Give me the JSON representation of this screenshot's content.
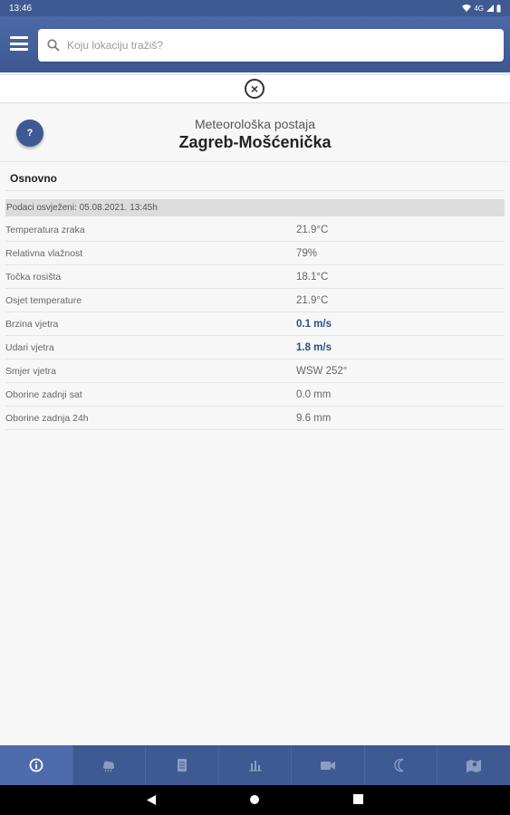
{
  "status_bar": {
    "time": "13:46",
    "network": "4G"
  },
  "search": {
    "placeholder": "Koju lokaciju tražiš?"
  },
  "help_button": {
    "label": "?"
  },
  "station": {
    "subtitle": "Meteorološka postaja",
    "name": "Zagreb-Mošćenička"
  },
  "section": {
    "title": "Osnovno"
  },
  "refresh": {
    "text": "Podaci osvježeni: 05.08.2021. 13:45h"
  },
  "rows": [
    {
      "label": "Temperatura zraka",
      "value": "21.9°C",
      "highlight": false
    },
    {
      "label": "Relativna vlažnost",
      "value": "79%",
      "highlight": false
    },
    {
      "label": "Točka rosišta",
      "value": "18.1°C",
      "highlight": false
    },
    {
      "label": "Osjet temperature",
      "value": "21.9°C",
      "highlight": false
    },
    {
      "label": "Brzina vjetra",
      "value": "0.1 m/s",
      "highlight": true
    },
    {
      "label": "Udari vjetra",
      "value": "1.8 m/s",
      "highlight": true
    },
    {
      "label": "Smjer vjetra",
      "value": "WSW 252°",
      "highlight": false
    },
    {
      "label": "Oborine zadnji sat",
      "value": "0.0 mm",
      "highlight": false
    },
    {
      "label": "Oborine zadnja 24h",
      "value": "9.6 mm",
      "highlight": false
    }
  ],
  "bottom_nav": [
    {
      "name": "tab-info",
      "icon": "info-icon",
      "active": true
    },
    {
      "name": "tab-forecast",
      "icon": "cloud-icon",
      "active": false
    },
    {
      "name": "tab-report",
      "icon": "document-icon",
      "active": false
    },
    {
      "name": "tab-charts",
      "icon": "bar-chart-icon",
      "active": false
    },
    {
      "name": "tab-camera",
      "icon": "video-camera-icon",
      "active": false
    },
    {
      "name": "tab-night",
      "icon": "moon-icon",
      "active": false
    },
    {
      "name": "tab-map",
      "icon": "map-icon",
      "active": false
    }
  ],
  "colors": {
    "primary": "#3f5a92",
    "active_tab": "#4e6cab",
    "highlight_value": "#2b4e8c"
  }
}
